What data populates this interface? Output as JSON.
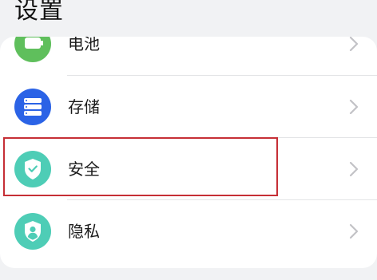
{
  "page": {
    "title": "设置"
  },
  "settings": {
    "items": [
      {
        "label": "电池",
        "icon": "battery-icon",
        "color": "#5fbf5c"
      },
      {
        "label": "存储",
        "icon": "storage-icon",
        "color": "#2b63e6"
      },
      {
        "label": "安全",
        "icon": "security-shield-icon",
        "color": "#4ecdb6"
      },
      {
        "label": "隐私",
        "icon": "privacy-icon",
        "color": "#4ecdb6"
      }
    ]
  },
  "annotation": {
    "highlight_color": "#c62f36"
  }
}
